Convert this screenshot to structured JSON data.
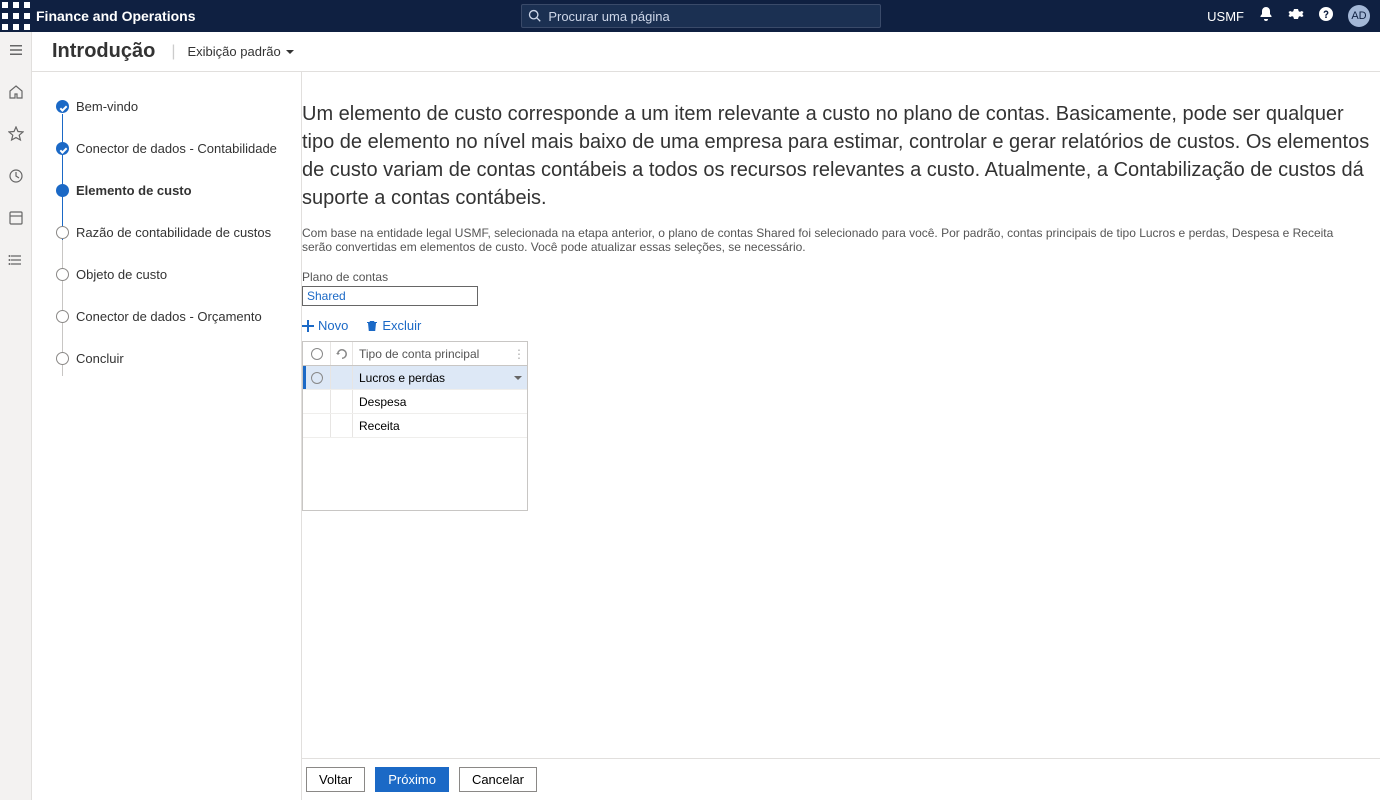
{
  "header": {
    "app_title": "Finance and Operations",
    "search_placeholder": "Procurar uma página",
    "env_label": "USMF",
    "avatar_initials": "AD"
  },
  "titlebar": {
    "page_title": "Introdução",
    "view_label": "Exibição padrão"
  },
  "wizard": {
    "steps": [
      {
        "label": "Bem-vindo",
        "state": "done"
      },
      {
        "label": "Conector de dados - Contabilidade",
        "state": "done"
      },
      {
        "label": "Elemento de custo",
        "state": "current"
      },
      {
        "label": "Razão de contabilidade de custos",
        "state": "pending"
      },
      {
        "label": "Objeto de custo",
        "state": "pending"
      },
      {
        "label": "Conector de dados - Orçamento",
        "state": "pending"
      },
      {
        "label": "Concluir",
        "state": "pending"
      }
    ]
  },
  "main": {
    "headline": "Um elemento de custo corresponde a um item relevante a custo no plano de contas. Basicamente, pode ser qualquer tipo de elemento no nível mais baixo de uma empresa para estimar, controlar e gerar relatórios de custos. Os elementos de custo variam de contas contábeis a todos os recursos relevantes a custo. Atualmente, a Contabilização de custos dá suporte a contas contábeis.",
    "subtext": "Com base na entidade legal USMF, selecionada na etapa anterior, o plano de contas Shared foi selecionado para você. Por padrão, contas principais de tipo Lucros e perdas, Despesa e Receita serão convertidas em elementos de custo. Você pode atualizar essas seleções, se necessário.",
    "field_label": "Plano de contas",
    "field_value": "Shared",
    "toolbar": {
      "new": "Novo",
      "delete": "Excluir"
    },
    "grid": {
      "header": "Tipo de conta principal",
      "rows": [
        {
          "value": "Lucros e perdas",
          "selected": true
        },
        {
          "value": "Despesa",
          "selected": false
        },
        {
          "value": "Receita",
          "selected": false
        }
      ]
    }
  },
  "footer": {
    "back": "Voltar",
    "next": "Próximo",
    "cancel": "Cancelar"
  }
}
